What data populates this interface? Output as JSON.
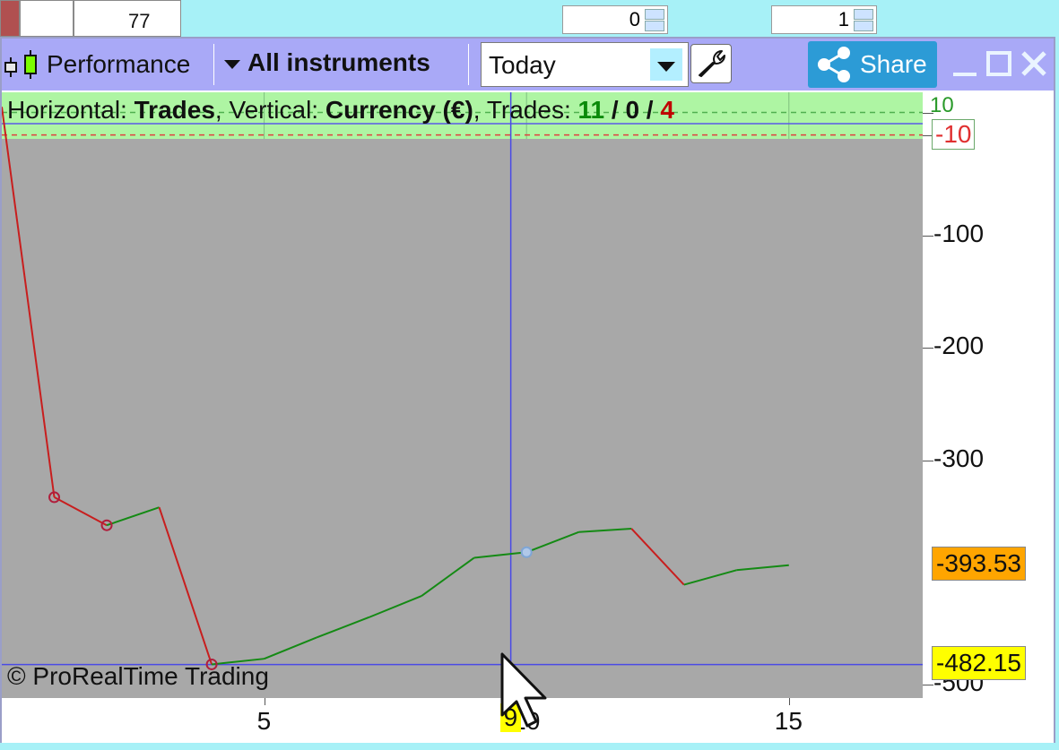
{
  "background": {
    "cells": [
      "77"
    ],
    "spinners": [
      "0",
      "1"
    ]
  },
  "window": {
    "title": "Performance",
    "instrument_label": "All instruments",
    "period_value": "Today",
    "share_label": "Share",
    "icons": {
      "title": "candlestick-icon",
      "period": "chevron-down-icon",
      "settings": "wrench-icon",
      "share": "share-icon",
      "minimize": "minimize-icon",
      "maximize": "maximize-icon",
      "close": "close-icon"
    }
  },
  "info_bar": {
    "horizontal_label": "Horizontal: ",
    "horizontal_value": "Trades",
    "vertical_label": ", Vertical: ",
    "vertical_value": "Currency (€)",
    "trades_label": ", Trades: ",
    "trades_win": "11",
    "sep1": " / ",
    "trades_even": "0",
    "sep2": " / ",
    "trades_loss": "4"
  },
  "copyright": "© ProRealTime Trading",
  "colors": {
    "gain": "#148a14",
    "loss": "#c81e1e",
    "crosshair": "#4a4ae6",
    "plot_background": "#a8a8a8",
    "band": "#aef5a3",
    "current_flag": "#ffa500",
    "cursor_flag": "#ffff00"
  },
  "chart_data": {
    "type": "line",
    "x": [
      0,
      1,
      2,
      3,
      4,
      5,
      6,
      7,
      8,
      9,
      10,
      11,
      12,
      13,
      14,
      15
    ],
    "values": [
      15,
      -333,
      -358,
      -342,
      -482,
      -477,
      -458,
      -440,
      -421,
      -387,
      -382,
      -364,
      -361,
      -411,
      -398,
      -393.53
    ],
    "segment_colors": [
      "loss",
      "loss",
      "gain",
      "loss",
      "gain",
      "gain",
      "gain",
      "gain",
      "gain",
      "gain",
      "gain",
      "gain",
      "loss",
      "gain",
      "gain"
    ],
    "markers": [
      1,
      2,
      4,
      10
    ],
    "x_ticks": [
      "5",
      "10",
      "15"
    ],
    "y_ticks": [
      "10",
      "-10",
      "-100",
      "-200",
      "-300",
      "-500"
    ],
    "y_flag_current": "-393.53",
    "y_flag_cursor": "-482.15",
    "x_flag_cursor": "9",
    "cursor_x": 9.7,
    "cursor_y": -482.15,
    "ref_lines": [
      10,
      0,
      -10
    ],
    "ylim": [
      -512,
      28
    ],
    "xlim": [
      0,
      17.55
    ]
  }
}
